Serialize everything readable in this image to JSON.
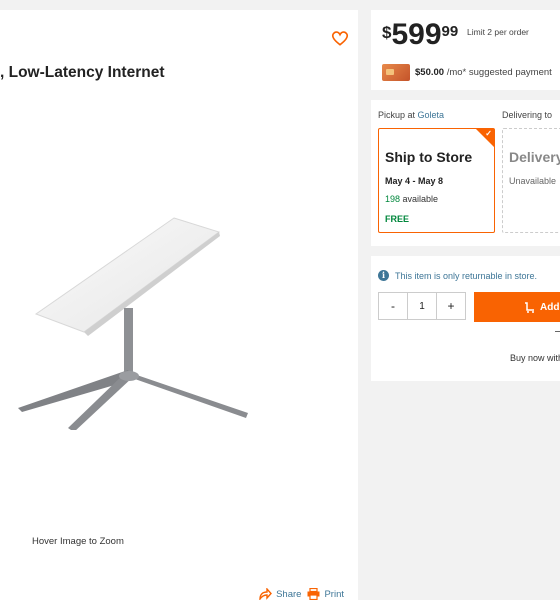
{
  "product": {
    "title": ", Low-Latency Internet",
    "hover_zoom": "Hover Image to Zoom",
    "share_label": "Share",
    "print_label": "Print"
  },
  "price": {
    "dollar_sign": "$",
    "whole": "599",
    "cents": "99",
    "limit": "Limit 2 per order",
    "payment_amount": "$50.00",
    "payment_suffix": " /mo* suggested payment"
  },
  "fulfillment": {
    "pickup_prefix": "Pickup at ",
    "pickup_store": "Goleta",
    "delivering_to": "Delivering to",
    "ship": {
      "title": "Ship to Store",
      "dates": "May 4 - May 8",
      "available_count": "198",
      "available_suffix": " available",
      "cost": "FREE"
    },
    "delivery": {
      "title": "Delivery",
      "status": "Unavailable"
    }
  },
  "cart": {
    "return_notice": "This item is only returnable in store.",
    "quantity": "1",
    "minus": "-",
    "plus": "+",
    "add_label": "Add",
    "buy_now": "Buy now with"
  },
  "colors": {
    "accent": "#f96302",
    "link": "#3e7697",
    "success": "#00873c"
  },
  "icons": [
    "heart-icon",
    "share-icon",
    "print-icon",
    "info-icon",
    "cart-icon",
    "checkmark-icon",
    "card-thumbnail"
  ]
}
